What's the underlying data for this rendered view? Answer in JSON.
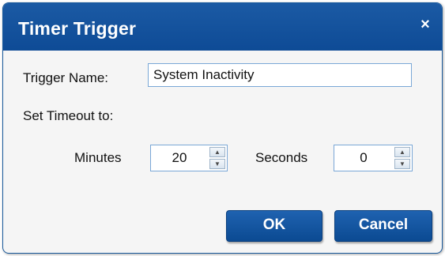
{
  "dialog": {
    "title": "Timer Trigger",
    "close_glyph": "×",
    "close_icon": "close-icon"
  },
  "trigger_name": {
    "label": "Trigger Name:",
    "value": "System Inactivity"
  },
  "timeout": {
    "label": "Set Timeout to:",
    "minutes_label": "Minutes",
    "minutes_value": "20",
    "seconds_label": "Seconds",
    "seconds_value": "0",
    "spin_up_icon": "caret-up-icon",
    "spin_down_icon": "caret-down-icon"
  },
  "buttons": {
    "ok": "OK",
    "cancel": "Cancel"
  },
  "colors": {
    "titlebar": "#0e4b96",
    "button": "#0b4a92",
    "field_border": "#7aa7d6"
  }
}
